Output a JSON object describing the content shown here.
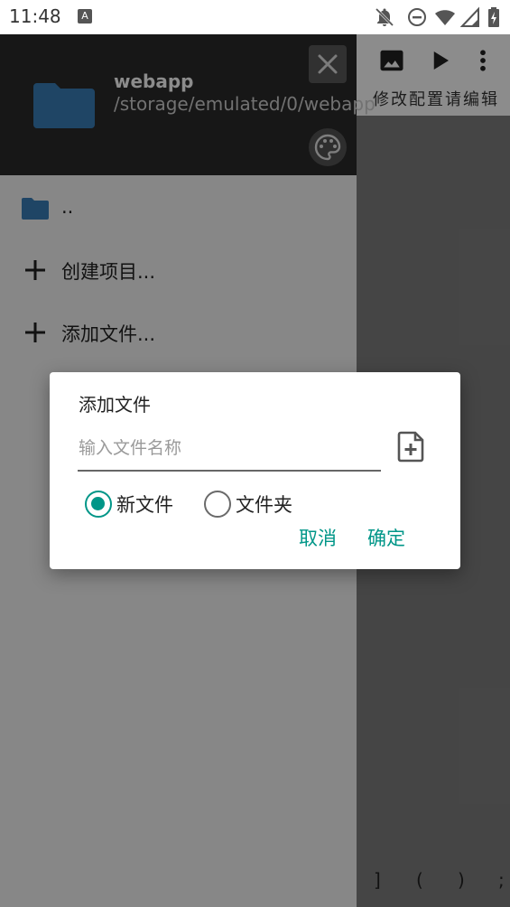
{
  "status_bar": {
    "time": "11:48",
    "notification_badge": "A",
    "icons": [
      "notifications-off-icon",
      "do-not-disturb-icon",
      "wifi-icon",
      "cellular-signal-icon",
      "battery-charging-icon"
    ]
  },
  "editor": {
    "toolbar_icons": [
      "image-icon",
      "play-icon",
      "more-vertical-icon"
    ],
    "menu_text": "修改配置请编辑",
    "bottom_symbols": [
      "]",
      "(",
      ")",
      ";"
    ]
  },
  "drawer": {
    "project_name": "webapp",
    "project_path": "/storage/emulated/0/webapp",
    "items": [
      {
        "label": "..",
        "icon": "folder-icon"
      },
      {
        "label": "创建项目...",
        "icon": "plus-icon"
      },
      {
        "label": "添加文件...",
        "icon": "plus-icon"
      }
    ],
    "folder_color": "#3a7fb8"
  },
  "dialog": {
    "title": "添加文件",
    "input_value": "",
    "input_placeholder": "输入文件名称",
    "radio_new_file": "新文件",
    "radio_folder": "文件夹",
    "selected": "新文件",
    "cancel_label": "取消",
    "confirm_label": "确定",
    "accent_color": "#009688"
  }
}
